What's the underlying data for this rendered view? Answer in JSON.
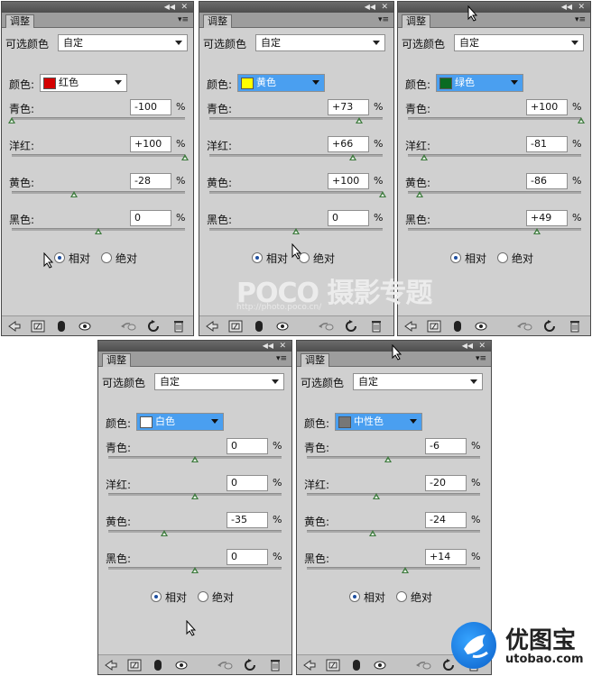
{
  "colors": {
    "slider_thumb": "#3e7a3e",
    "highlight": "#4a9ff0",
    "panel_bg": "#d0d0d0",
    "titlebar": "#555555"
  },
  "panels": [
    {
      "tab": "调整",
      "preset_label": "可选颜色",
      "preset_value": "自定",
      "color_label": "颜色:",
      "color_name": "红色",
      "swatch": "#d40000",
      "highlighted": false,
      "sliders": [
        {
          "label": "青色:",
          "value": "-100",
          "unit": "%",
          "level": -100
        },
        {
          "label": "洋红:",
          "value": "+100",
          "unit": "%",
          "level": 100
        },
        {
          "label": "黄色:",
          "value": "-28",
          "unit": "%",
          "level": -28
        },
        {
          "label": "黑色:",
          "value": "0",
          "unit": "%",
          "level": 0
        }
      ],
      "method": {
        "relative": "相对",
        "absolute": "绝对",
        "selected": "relative"
      }
    },
    {
      "tab": "调整",
      "preset_label": "可选颜色",
      "preset_value": "自定",
      "color_label": "颜色:",
      "color_name": "黄色",
      "swatch": "#ffff00",
      "highlighted": true,
      "sliders": [
        {
          "label": "青色:",
          "value": "+73",
          "unit": "%",
          "level": 73
        },
        {
          "label": "洋红:",
          "value": "+66",
          "unit": "%",
          "level": 66
        },
        {
          "label": "黄色:",
          "value": "+100",
          "unit": "%",
          "level": 100
        },
        {
          "label": "黑色:",
          "value": "0",
          "unit": "%",
          "level": 0
        }
      ],
      "method": {
        "relative": "相对",
        "absolute": "绝对",
        "selected": "relative"
      }
    },
    {
      "tab": "调整",
      "preset_label": "可选颜色",
      "preset_value": "自定",
      "color_label": "颜色:",
      "color_name": "绿色",
      "swatch": "#0a6b22",
      "highlighted": true,
      "sliders": [
        {
          "label": "青色:",
          "value": "+100",
          "unit": "%",
          "level": 100
        },
        {
          "label": "洋红:",
          "value": "-81",
          "unit": "%",
          "level": -81
        },
        {
          "label": "黄色:",
          "value": "-86",
          "unit": "%",
          "level": -86
        },
        {
          "label": "黑色:",
          "value": "+49",
          "unit": "%",
          "level": 49
        }
      ],
      "method": {
        "relative": "相对",
        "absolute": "绝对",
        "selected": "relative"
      }
    },
    {
      "tab": "调整",
      "preset_label": "可选颜色",
      "preset_value": "自定",
      "color_label": "颜色:",
      "color_name": "白色",
      "swatch": "#ffffff",
      "highlighted": true,
      "sliders": [
        {
          "label": "青色:",
          "value": "0",
          "unit": "%",
          "level": 0
        },
        {
          "label": "洋红:",
          "value": "0",
          "unit": "%",
          "level": 0
        },
        {
          "label": "黄色:",
          "value": "-35",
          "unit": "%",
          "level": -35
        },
        {
          "label": "黑色:",
          "value": "0",
          "unit": "%",
          "level": 0
        }
      ],
      "method": {
        "relative": "相对",
        "absolute": "绝对",
        "selected": "relative"
      }
    },
    {
      "tab": "调整",
      "preset_label": "可选颜色",
      "preset_value": "自定",
      "color_label": "颜色:",
      "color_name": "中性色",
      "swatch": "#777777",
      "highlighted": true,
      "sliders": [
        {
          "label": "青色:",
          "value": "-6",
          "unit": "%",
          "level": -6
        },
        {
          "label": "洋红:",
          "value": "-20",
          "unit": "%",
          "level": -20
        },
        {
          "label": "黄色:",
          "value": "-24",
          "unit": "%",
          "level": -24
        },
        {
          "label": "黑色:",
          "value": "+14",
          "unit": "%",
          "level": 14
        }
      ],
      "method": {
        "relative": "相对",
        "absolute": "绝对",
        "selected": "relative"
      }
    }
  ],
  "watermark": {
    "title": "POCO 摄影专题",
    "url": "http://photo.poco.cn/"
  },
  "branding": {
    "name": "优图宝",
    "url": "utobao.com"
  }
}
